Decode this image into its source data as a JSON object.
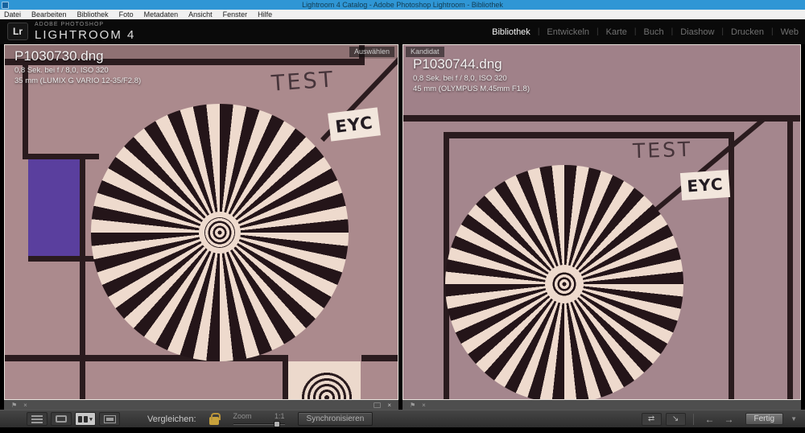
{
  "window": {
    "title": "Lightroom 4 Catalog - Adobe Photoshop Lightroom - Bibliothek"
  },
  "menu": {
    "items": [
      "Datei",
      "Bearbeiten",
      "Bibliothek",
      "Foto",
      "Metadaten",
      "Ansicht",
      "Fenster",
      "Hilfe"
    ]
  },
  "header": {
    "logo": "Lr",
    "brand_top": "ADOBE PHOTOSHOP",
    "brand_bottom": "LIGHTROOM 4",
    "separator": "|",
    "modules": [
      {
        "label": "Bibliothek",
        "active": true
      },
      {
        "label": "Entwickeln",
        "active": false
      },
      {
        "label": "Karte",
        "active": false
      },
      {
        "label": "Buch",
        "active": false
      },
      {
        "label": "Diashow",
        "active": false
      },
      {
        "label": "Drucken",
        "active": false
      },
      {
        "label": "Web",
        "active": false
      }
    ]
  },
  "compare": {
    "select": {
      "badge": "Auswählen",
      "filename": "P1030730.dng",
      "exposure": "0,8 Sek. bei f / 8,0, ISO 320",
      "lens": "35 mm (LUMIX G VARIO 12-35/F2.8)",
      "chart": {
        "test_label": "TEST",
        "eyc_label": "EYC"
      }
    },
    "candidate": {
      "badge": "Kandidat",
      "filename": "P1030744.dng",
      "exposure": "0,8 Sek. bei f / 8,0, ISO 320",
      "lens": "45 mm (OLYMPUS M.45mm F1.8)",
      "chart": {
        "test_label": "TEST",
        "eyc_label": "EYC"
      }
    }
  },
  "toolbar": {
    "compare_label": "Vergleichen:",
    "zoom_label": "Zoom",
    "zoom_ratio": "1:1",
    "sync_button": "Synchronisieren",
    "done_button": "Fertig"
  },
  "icons": {
    "flag": "⚑",
    "reject": "×",
    "swap": "⇄",
    "make_select": "↘",
    "prev": "←",
    "next": "→",
    "dropdown": "▼"
  },
  "colors": {
    "titlebar_blue": "#2f96d5",
    "mauve_left": "#ab8a8d",
    "mauve_right": "#a4868d",
    "chart_purple": "#5a3f9e",
    "star_dark": "#241519",
    "star_light": "#eedacd",
    "lock_gold": "#c8a23c"
  }
}
